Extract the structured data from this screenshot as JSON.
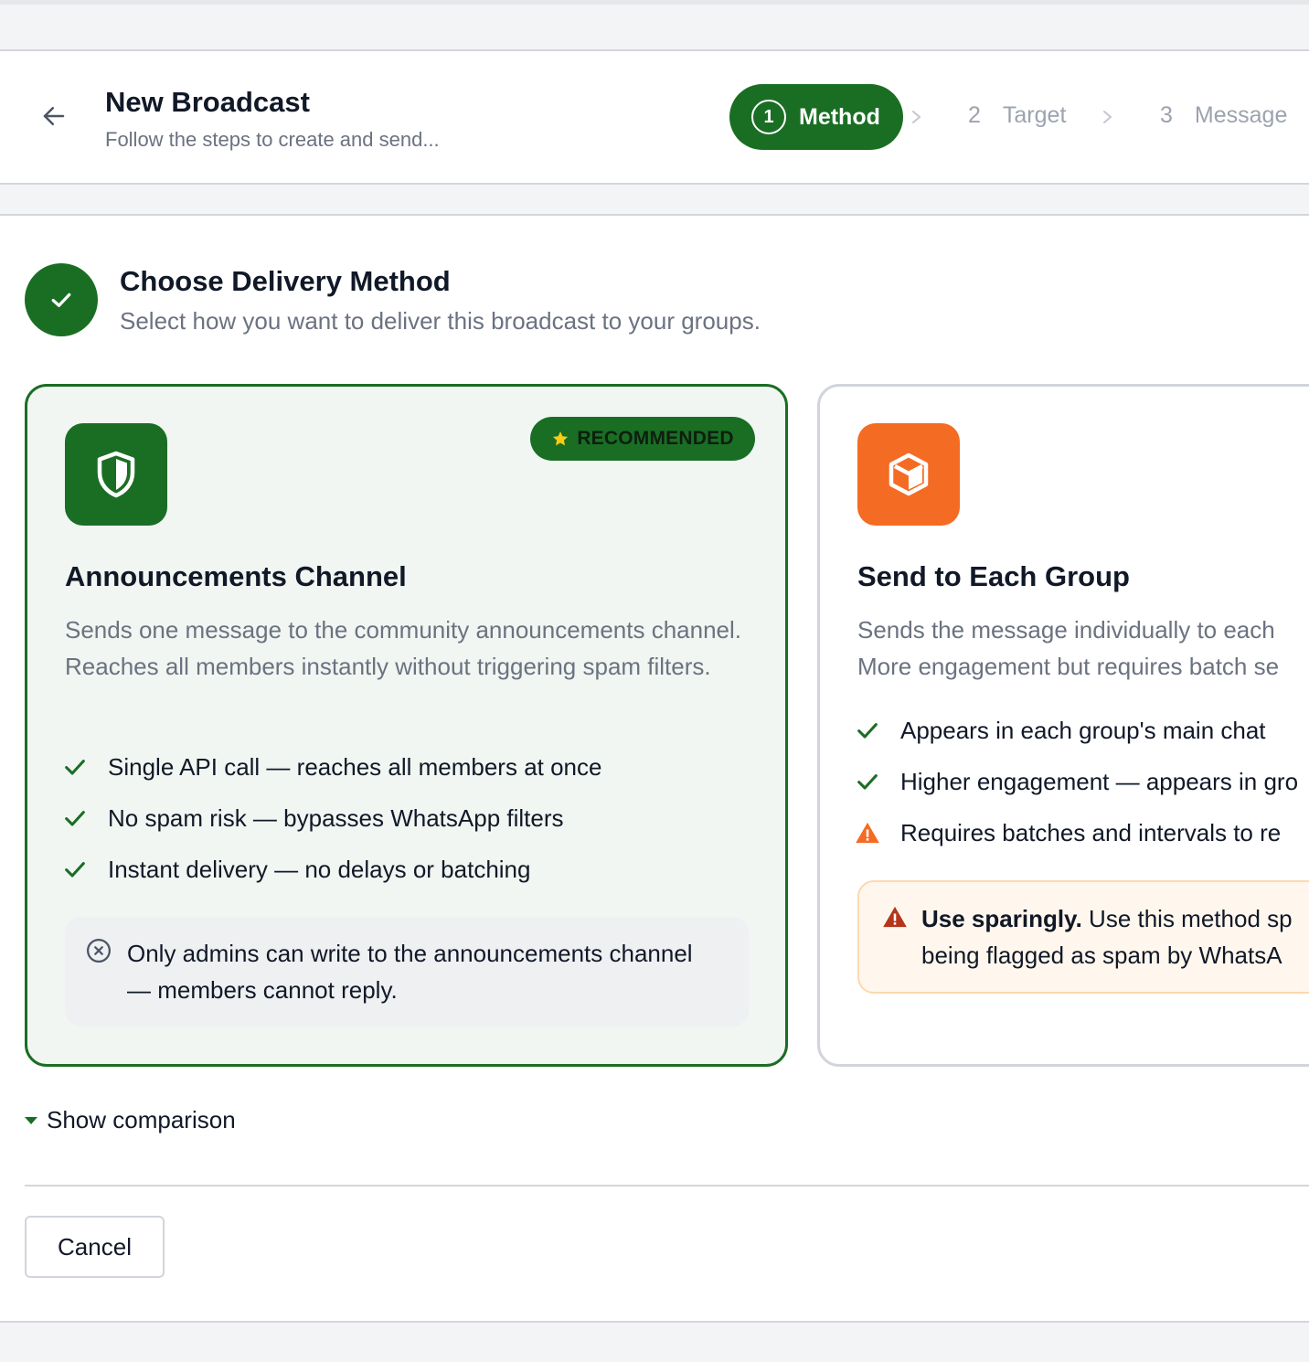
{
  "header": {
    "title": "New Broadcast",
    "subtitle": "Follow the steps to create and send...",
    "steps": [
      {
        "num": "1",
        "label": "Method",
        "active": true
      },
      {
        "num": "2",
        "label": "Target",
        "active": false
      },
      {
        "num": "3",
        "label": "Message",
        "active": false
      }
    ]
  },
  "section": {
    "title": "Choose Delivery Method",
    "subtitle": "Select how you want to deliver this broadcast to your groups."
  },
  "cards": [
    {
      "title": "Announcements Channel",
      "badge": "RECOMMENDED",
      "icon": "shield-icon",
      "description": "Sends one message to the community announcements channel. Reaches all members instantly without triggering spam filters.",
      "features": [
        "Single API call — reaches all members at once",
        "No spam risk — bypasses WhatsApp filters",
        "Instant delivery — no delays or batching"
      ],
      "note": "Only admins can write to the announcements channel — members cannot reply.",
      "selected": true
    },
    {
      "title": "Send to Each Group",
      "icon": "box-icon",
      "description_lines": [
        "Sends the message individually to each",
        "More engagement but requires batch se"
      ],
      "features": [
        "Appears in each group's main chat",
        "Higher engagement — appears in gro",
        "Requires batches and intervals to re"
      ],
      "warning_strong": "Use sparingly.",
      "warning_rest": " Use this method sp",
      "warning_line2": "being flagged as spam by WhatsA",
      "selected": false
    }
  ],
  "comparison_toggle": "Show comparison",
  "cancel_label": "Cancel",
  "colors": {
    "primary_green": "#1a6e24",
    "orange": "#f46b24",
    "warning_bg": "#fff7ed",
    "muted_text": "#6b7280"
  }
}
